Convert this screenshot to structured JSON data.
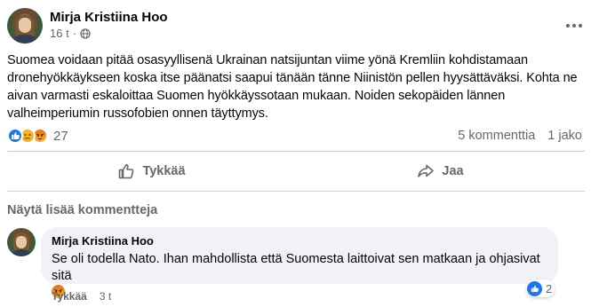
{
  "post": {
    "author": "Mirja Kristiina Hoo",
    "timestamp": "16 t",
    "privacy_icon": "globe-icon",
    "text": "Suomea voidaan pitää osasyyllisenä Ukrainan natsijuntan viime yönä Kremliin kohdistamaan dronehyökkäykseen koska itse päänatsi saapui tänään tänne Niinistön pellen hyysättäväksi. Kohta ne aivan varmasti eskaloittaa Suomen hyökkäyssotaan mukaan. Noiden sekopäiden lännen valheimperiumin russofobien onnen täyttymys.",
    "reaction_count": "27",
    "comment_count": "5 kommenttia",
    "share_count": "1 jako"
  },
  "actions": {
    "like_label": "Tykkää",
    "share_label": "Jaa"
  },
  "comments_section": {
    "more_comments_label": "Näytä lisää kommentteja"
  },
  "comment": {
    "author": "Mirja Kristiina Hoo",
    "text": "Se oli todella Nato. Ihan mahdollista että Suomesta laittoivat sen matkaan ja ohjasivat sitä",
    "reaction_count": "2",
    "like_label": "Tykkää",
    "timestamp": "3 t"
  },
  "colors": {
    "accent": "#1877f2",
    "secondary_text": "#65676b",
    "bubble": "#f0f2f5"
  }
}
